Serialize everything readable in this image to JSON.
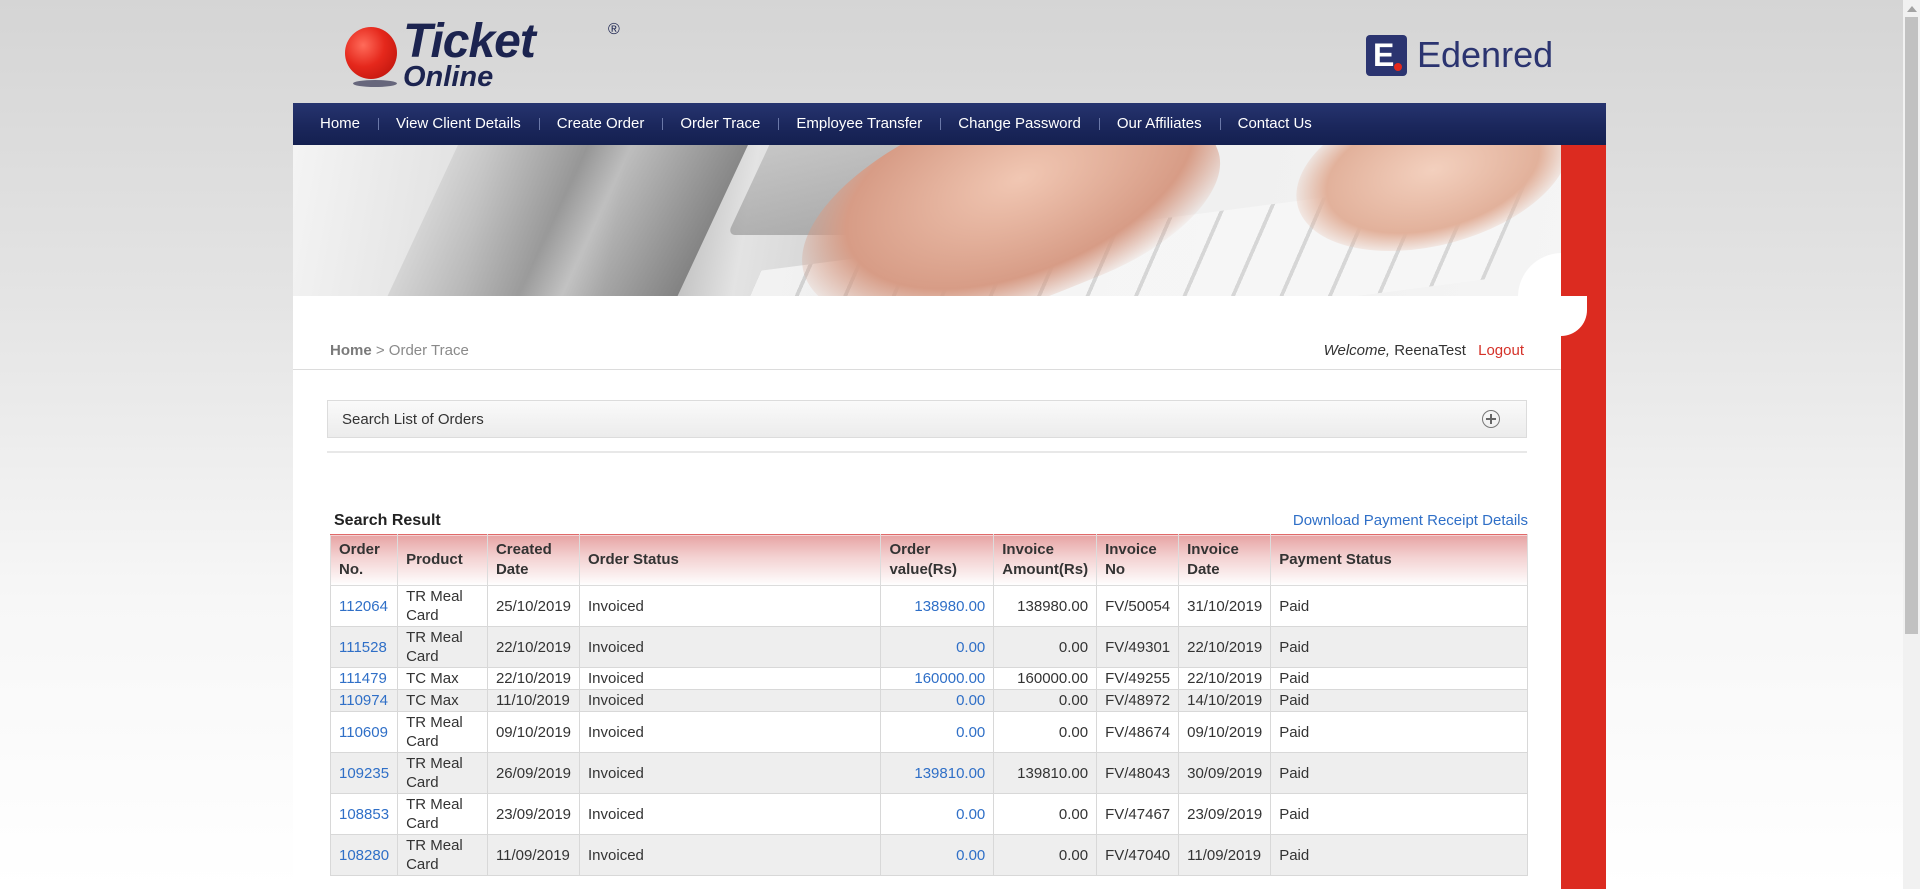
{
  "brand": {
    "ticket_line1": "Ticket",
    "ticket_line2": "Online",
    "registered": "®",
    "partner": "Edenred"
  },
  "nav": [
    {
      "label": "Home"
    },
    {
      "label": "View Client Details"
    },
    {
      "label": "Create Order"
    },
    {
      "label": "Order Trace"
    },
    {
      "label": "Employee Transfer"
    },
    {
      "label": "Change Password"
    },
    {
      "label": "Our Affiliates"
    },
    {
      "label": "Contact Us"
    }
  ],
  "breadcrumb": {
    "home": "Home",
    "sep": " > ",
    "current": "Order Trace"
  },
  "user": {
    "welcome": "Welcome,",
    "name": "ReenaTest",
    "logout": "Logout"
  },
  "search_panel": {
    "label": "Search List of Orders"
  },
  "results": {
    "title": "Search Result",
    "download": "Download Payment Receipt Details",
    "columns": [
      "Order No.",
      "Product",
      "Created Date",
      "Order Status",
      "Order value(Rs)",
      "Invoice Amount(Rs)",
      "Invoice No",
      "Invoice Date",
      "Payment Status"
    ],
    "rows": [
      {
        "order_no": "112064",
        "product": "TR Meal Card",
        "created": "25/10/2019",
        "status": "Invoiced",
        "order_value": "138980.00",
        "invoice_amount": "138980.00",
        "invoice_no": "FV/50054",
        "invoice_date": "31/10/2019",
        "payment": "Paid"
      },
      {
        "order_no": "111528",
        "product": "TR Meal Card",
        "created": "22/10/2019",
        "status": "Invoiced",
        "order_value": "0.00",
        "invoice_amount": "0.00",
        "invoice_no": "FV/49301",
        "invoice_date": "22/10/2019",
        "payment": "Paid"
      },
      {
        "order_no": "111479",
        "product": "TC Max",
        "created": "22/10/2019",
        "status": "Invoiced",
        "order_value": "160000.00",
        "invoice_amount": "160000.00",
        "invoice_no": "FV/49255",
        "invoice_date": "22/10/2019",
        "payment": "Paid"
      },
      {
        "order_no": "110974",
        "product": "TC Max",
        "created": "11/10/2019",
        "status": "Invoiced",
        "order_value": "0.00",
        "invoice_amount": "0.00",
        "invoice_no": "FV/48972",
        "invoice_date": "14/10/2019",
        "payment": "Paid"
      },
      {
        "order_no": "110609",
        "product": "TR Meal Card",
        "created": "09/10/2019",
        "status": "Invoiced",
        "order_value": "0.00",
        "invoice_amount": "0.00",
        "invoice_no": "FV/48674",
        "invoice_date": "09/10/2019",
        "payment": "Paid"
      },
      {
        "order_no": "109235",
        "product": "TR Meal Card",
        "created": "26/09/2019",
        "status": "Invoiced",
        "order_value": "139810.00",
        "invoice_amount": "139810.00",
        "invoice_no": "FV/48043",
        "invoice_date": "30/09/2019",
        "payment": "Paid"
      },
      {
        "order_no": "108853",
        "product": "TR Meal Card",
        "created": "23/09/2019",
        "status": "Invoiced",
        "order_value": "0.00",
        "invoice_amount": "0.00",
        "invoice_no": "FV/47467",
        "invoice_date": "23/09/2019",
        "payment": "Paid"
      },
      {
        "order_no": "108280",
        "product": "TR Meal Card",
        "created": "11/09/2019",
        "status": "Invoiced",
        "order_value": "0.00",
        "invoice_amount": "0.00",
        "invoice_no": "FV/47040",
        "invoice_date": "11/09/2019",
        "payment": "Paid"
      }
    ]
  },
  "colors": {
    "nav_bg": "#1b275c",
    "accent_red": "#dc2b20",
    "link": "#2f6fc7",
    "header_gradient_top": "#e7a4a4"
  }
}
